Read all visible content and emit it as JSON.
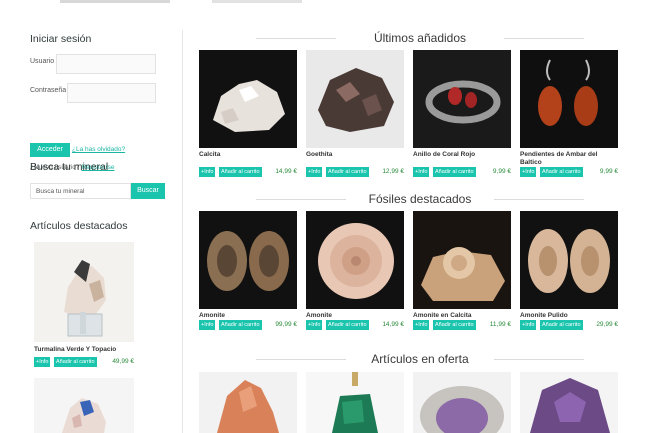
{
  "colors": {
    "accent": "#1bc5ad",
    "price": "#2a8a3a"
  },
  "sidebar": {
    "login": {
      "title": "Iniciar sesión",
      "user_label": "Usuario",
      "password_label": "Contraseña",
      "submit_label": "Acceder",
      "forgot_link": "¿La has olvidado?",
      "new_user_text": "¿Nuevo usuario?",
      "register_link": "Registrarse"
    },
    "search": {
      "title": "Busca tu mineral",
      "placeholder": "Busca tu mineral",
      "button_label": "Buscar"
    },
    "featured": {
      "title": "Artículos destacados",
      "items": [
        {
          "name": "Turmalina Verde Y Topacio",
          "price": "49,99 €",
          "info": "+Info",
          "cart": "Añadir al carrito"
        }
      ]
    }
  },
  "sections": [
    {
      "title": "Últimos añadidos",
      "products": [
        {
          "name": "Calcita",
          "price": "14,99 €",
          "info": "+Info",
          "cart": "Añadir al carrito"
        },
        {
          "name": "Goethita",
          "price": "12,99 €",
          "info": "+Info",
          "cart": "Añadir al carrito"
        },
        {
          "name": "Anillo de Coral Rojo",
          "price": "9,99 €",
          "info": "+Info",
          "cart": "Añadir al carrito"
        },
        {
          "name": "Pendientes de Ambar del Baltico",
          "price": "9,99 €",
          "info": "+Info",
          "cart": "Añadir al carrito"
        }
      ]
    },
    {
      "title": "Fósiles destacados",
      "products": [
        {
          "name": "Amonite",
          "price": "99,99 €",
          "info": "+Info",
          "cart": "Añadir al carrito"
        },
        {
          "name": "Amonite",
          "price": "14,99 €",
          "info": "+Info",
          "cart": "Añadir al carrito"
        },
        {
          "name": "Amonite en Calcita",
          "price": "11,99 €",
          "info": "+Info",
          "cart": "Añadir al carrito"
        },
        {
          "name": "Amonite Pulido",
          "price": "29,99 €",
          "info": "+Info",
          "cart": "Añadir al carrito"
        }
      ]
    },
    {
      "title": "Artículos en oferta",
      "products": []
    }
  ]
}
